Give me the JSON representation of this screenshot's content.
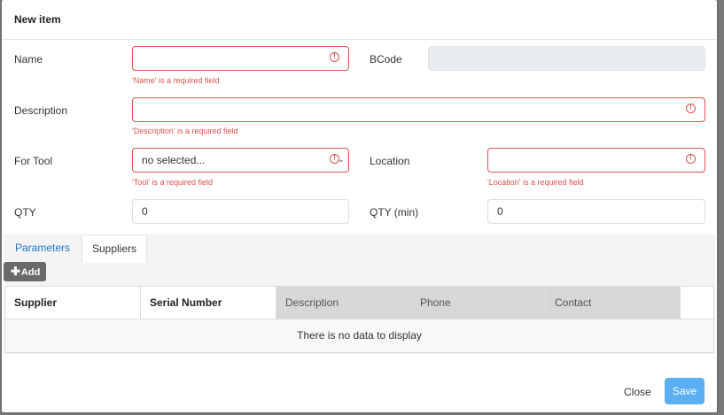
{
  "dialog": {
    "title": "New item"
  },
  "form": {
    "name": {
      "label": "Name",
      "value": "",
      "error": "'Name' is a required field"
    },
    "bcode": {
      "label": "BCode",
      "value": ""
    },
    "description": {
      "label": "Description",
      "value": "",
      "error": "'Description' is a required field"
    },
    "for_tool": {
      "label": "For Tool",
      "value": "no selected...",
      "error": "'Tool' is a required field"
    },
    "location": {
      "label": "Location",
      "value": "",
      "error": "'Location' is a required field"
    },
    "qty": {
      "label": "QTY",
      "value": "0"
    },
    "qty_min": {
      "label": "QTY (min)",
      "value": "0"
    }
  },
  "tabs": [
    {
      "label": "Parameters",
      "active": false
    },
    {
      "label": "Suppliers",
      "active": true
    }
  ],
  "toolbar": {
    "add_label": "Add"
  },
  "grid": {
    "columns": [
      "Supplier",
      "Serial Number",
      "Description",
      "Phone",
      "Contact"
    ],
    "empty_text": "There is no data to display"
  },
  "footer": {
    "close_label": "Close",
    "save_label": "Save"
  },
  "colors": {
    "error": "#d9534f",
    "accent": "#1a73c4",
    "save_button": "#5aaef2"
  }
}
